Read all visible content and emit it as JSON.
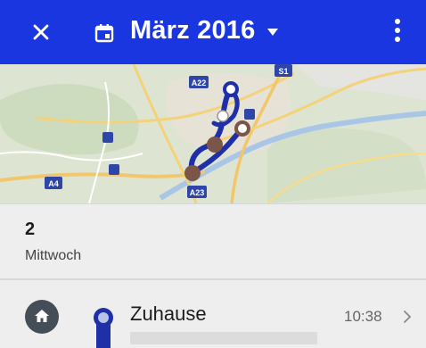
{
  "toolbar": {
    "title": "März 2016",
    "close_icon": "close-icon",
    "calendar_icon": "calendar-icon",
    "dropdown_icon": "caret-down-icon",
    "more_icon": "more-vert-icon",
    "background_color": "#1a36e0"
  },
  "map": {
    "route_color": "#1f2fa8",
    "stop_color": "#7a5548",
    "road_labels": [
      "A22",
      "S1",
      "A4",
      "A23"
    ]
  },
  "day": {
    "number": "2",
    "weekday": "Mittwoch"
  },
  "timeline_items": [
    {
      "name": "Zuhause",
      "time": "10:38",
      "icon": "home-icon",
      "accent_color": "#1f2fa8"
    }
  ]
}
